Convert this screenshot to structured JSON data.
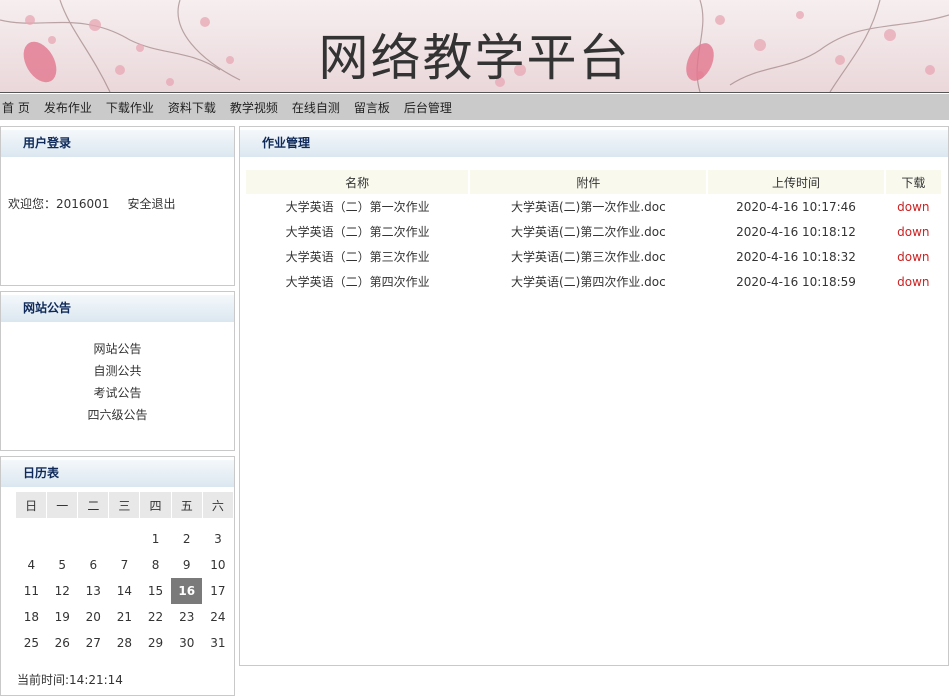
{
  "banner": {
    "title": "网络教学平台"
  },
  "nav": [
    "首 页",
    "发布作业",
    "下载作业",
    "资料下载",
    "教学视频",
    "在线自测",
    "留言板",
    "后台管理"
  ],
  "login": {
    "header": "用户登录",
    "welcome": "欢迎您：2016001",
    "logout": "安全退出"
  },
  "notice": {
    "header": "网站公告",
    "items": [
      "网站公告",
      "自测公共",
      "考试公告",
      "四六级公告"
    ]
  },
  "calendar": {
    "header": "日历表",
    "weekdays": [
      "日",
      "一",
      "二",
      "三",
      "四",
      "五",
      "六"
    ],
    "weeks": [
      [
        "",
        "",
        "",
        "",
        "1",
        "2",
        "3"
      ],
      [
        "4",
        "5",
        "6",
        "7",
        "8",
        "9",
        "10"
      ],
      [
        "11",
        "12",
        "13",
        "14",
        "15",
        "16",
        "17"
      ],
      [
        "18",
        "19",
        "20",
        "21",
        "22",
        "23",
        "24"
      ],
      [
        "25",
        "26",
        "27",
        "28",
        "29",
        "30",
        "31"
      ]
    ],
    "today": "16",
    "clock": "当前时间:14:21:14"
  },
  "homework": {
    "header": "作业管理",
    "columns": [
      "名称",
      "附件",
      "上传时间",
      "下载"
    ],
    "rows": [
      [
        "大学英语（二）第一次作业",
        "大学英语(二)第一次作业.doc",
        "2020-4-16 10:17:46",
        "down"
      ],
      [
        "大学英语（二）第二次作业",
        "大学英语(二)第二次作业.doc",
        "2020-4-16 10:18:12",
        "down"
      ],
      [
        "大学英语（二）第三次作业",
        "大学英语(二)第三次作业.doc",
        "2020-4-16 10:18:32",
        "down"
      ],
      [
        "大学英语（二）第四次作业",
        "大学英语(二)第四次作业.doc",
        "2020-4-16 10:18:59",
        "down"
      ]
    ]
  },
  "colors": {
    "nav_bg": "#cacaca",
    "panel_header_text": "#0f2a5a",
    "download_link": "#cc2222",
    "today_bg": "#7a7a7a"
  }
}
